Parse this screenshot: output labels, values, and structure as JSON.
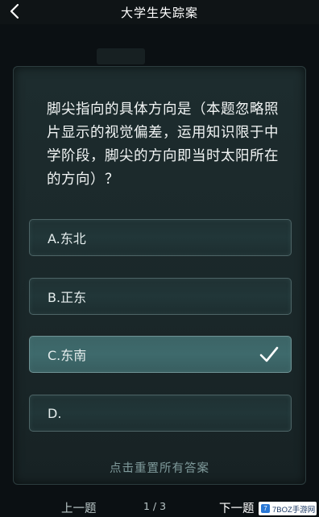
{
  "header": {
    "title": "大学生失踪案",
    "back_icon": "chevron-left-icon"
  },
  "question": {
    "text": "脚尖指向的具体方向是（本题忽略照片显示的视觉偏差，运用知识限于中学阶段，脚尖的方向即当时太阳所在的方向）？"
  },
  "options": [
    {
      "label": "A.东北",
      "selected": false
    },
    {
      "label": "B.正东",
      "selected": false
    },
    {
      "label": "C.东南",
      "selected": true
    },
    {
      "label": "D.",
      "selected": false
    }
  ],
  "reset_label": "点击重置所有答案",
  "footer": {
    "prev_label": "上一题",
    "page_indicator": "1 / 3",
    "next_label": "下一题"
  },
  "watermark": {
    "icon_text": "7",
    "text": "7BOZ手游网"
  },
  "colors": {
    "background": "#0b1013",
    "card": "#1d2c2e",
    "selected_option": "#3e6a6c"
  }
}
